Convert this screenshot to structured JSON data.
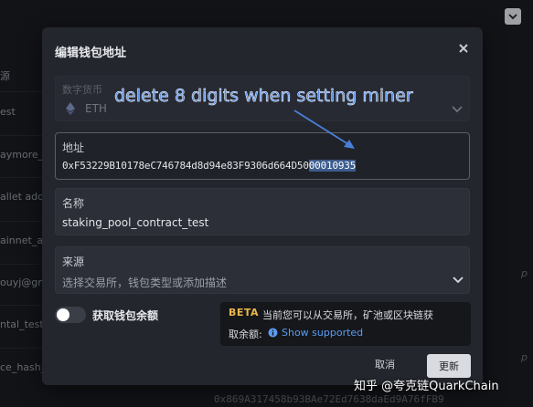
{
  "background": {
    "sidebar_items": [
      "源",
      "est",
      "aymore_t",
      "allet add",
      "ainnet_ac",
      "ouyj@gm",
      "ntal_test",
      "ce_hash_"
    ],
    "right_labels": [
      "p",
      "p"
    ],
    "hash_text": "0x869A317458b93BAe72Ed7638daEd9A76fFB9"
  },
  "modal": {
    "title": "编辑钱包地址",
    "chain": {
      "label": "数字货币",
      "value": "ETH"
    },
    "address": {
      "label": "地址",
      "value_plain": "0xF53229B10178eC746784d8d94e83F9306d664D50",
      "value_selected": "00010935"
    },
    "name": {
      "label": "名称",
      "value": "staking_pool_contract_test"
    },
    "source": {
      "label": "来源",
      "placeholder": "选择交易所，钱包类型或添加描述"
    },
    "balance_toggle": {
      "label": "获取钱包余额",
      "on": false
    },
    "beta": {
      "tag": "BETA",
      "line1": "当前您可以从交易所，矿池或区块链获",
      "line2_prefix": "取余额:",
      "link": "Show supported"
    },
    "buttons": {
      "cancel": "取消",
      "update": "更新"
    }
  },
  "annotation": {
    "text": "delete 8 digits when setting miner"
  },
  "watermark": {
    "text": "知乎 @夸克链QuarkChain"
  },
  "colors": {
    "modal_bg": "#23262d",
    "accent_link": "#5b9bf0",
    "beta": "#e9b84a",
    "annotation": "#5a8fe6",
    "selection": "#3d5c8e"
  },
  "icons": [
    "close-icon",
    "ethereum-icon",
    "chevron-down-icon",
    "info-icon",
    "arrow-icon"
  ]
}
